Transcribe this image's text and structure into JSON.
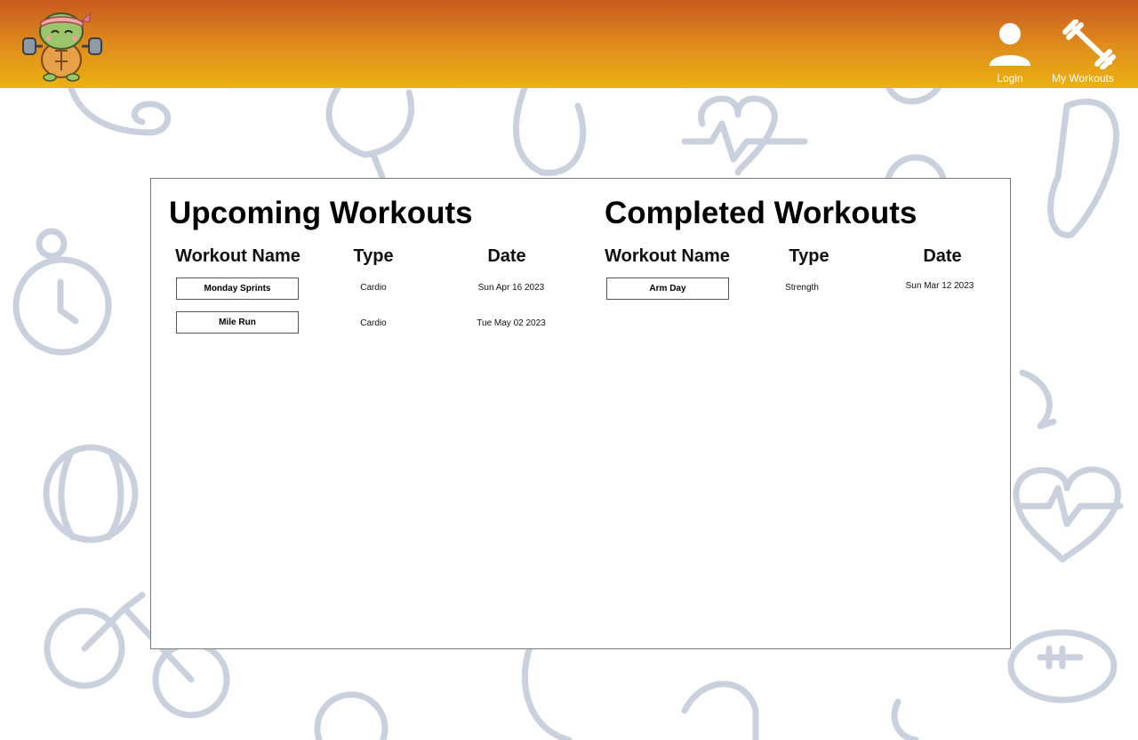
{
  "header": {
    "nav": {
      "login_label": "Login",
      "my_workouts_label": "My Workouts"
    },
    "colors": {
      "gradient_top": "#c85a1e",
      "gradient_bottom": "#ecb212"
    }
  },
  "upcoming": {
    "title": "Upcoming Workouts",
    "columns": {
      "name": "Workout Name",
      "type": "Type",
      "date": "Date"
    },
    "rows": [
      {
        "name": "Monday Sprints",
        "type": "Cardio",
        "date": "Sun Apr 16 2023"
      },
      {
        "name": "Mile Run",
        "type": "Cardio",
        "date": "Tue May 02 2023"
      }
    ]
  },
  "completed": {
    "title": "Completed Workouts",
    "columns": {
      "name": "Workout Name",
      "type": "Type",
      "date": "Date"
    },
    "rows": [
      {
        "name": "Arm Day",
        "type": "Strength",
        "date": "Sun Mar 12 2023"
      }
    ]
  },
  "icons": {
    "logo": "turtle-mascot-logo",
    "login": "user-icon",
    "my_workouts": "dumbbell-icon"
  }
}
